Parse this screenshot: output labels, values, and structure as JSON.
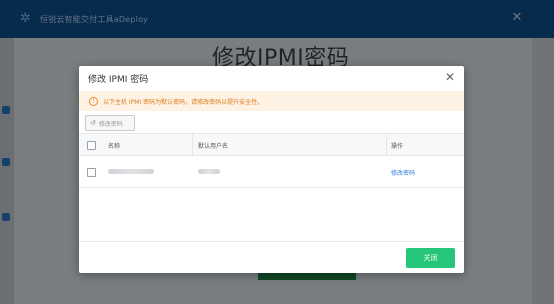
{
  "app": {
    "title": "恒锐云智能交付工具aDeploy",
    "close_glyph": "✕",
    "logo_glyph": "✲",
    "page_title": "修改IPMI密码"
  },
  "dialog": {
    "title": "修改 IPMI 密码",
    "close_glyph": "✕",
    "notice": {
      "icon_glyph": "!",
      "text": "以下主机 IPMI 密码为默认密码，请修改密码以提升安全性。",
      "color": "#e07b1e"
    },
    "toolbar": {
      "modify_icon_glyph": "↺",
      "modify_label": "修改密码"
    },
    "table": {
      "columns": [
        "名称",
        "默认用户名",
        "操作"
      ],
      "rows": [
        {
          "name": "",
          "username": "",
          "action": "修改密码"
        }
      ]
    },
    "footer": {
      "close_label": "关闭",
      "close_color": "#25c67a"
    }
  }
}
